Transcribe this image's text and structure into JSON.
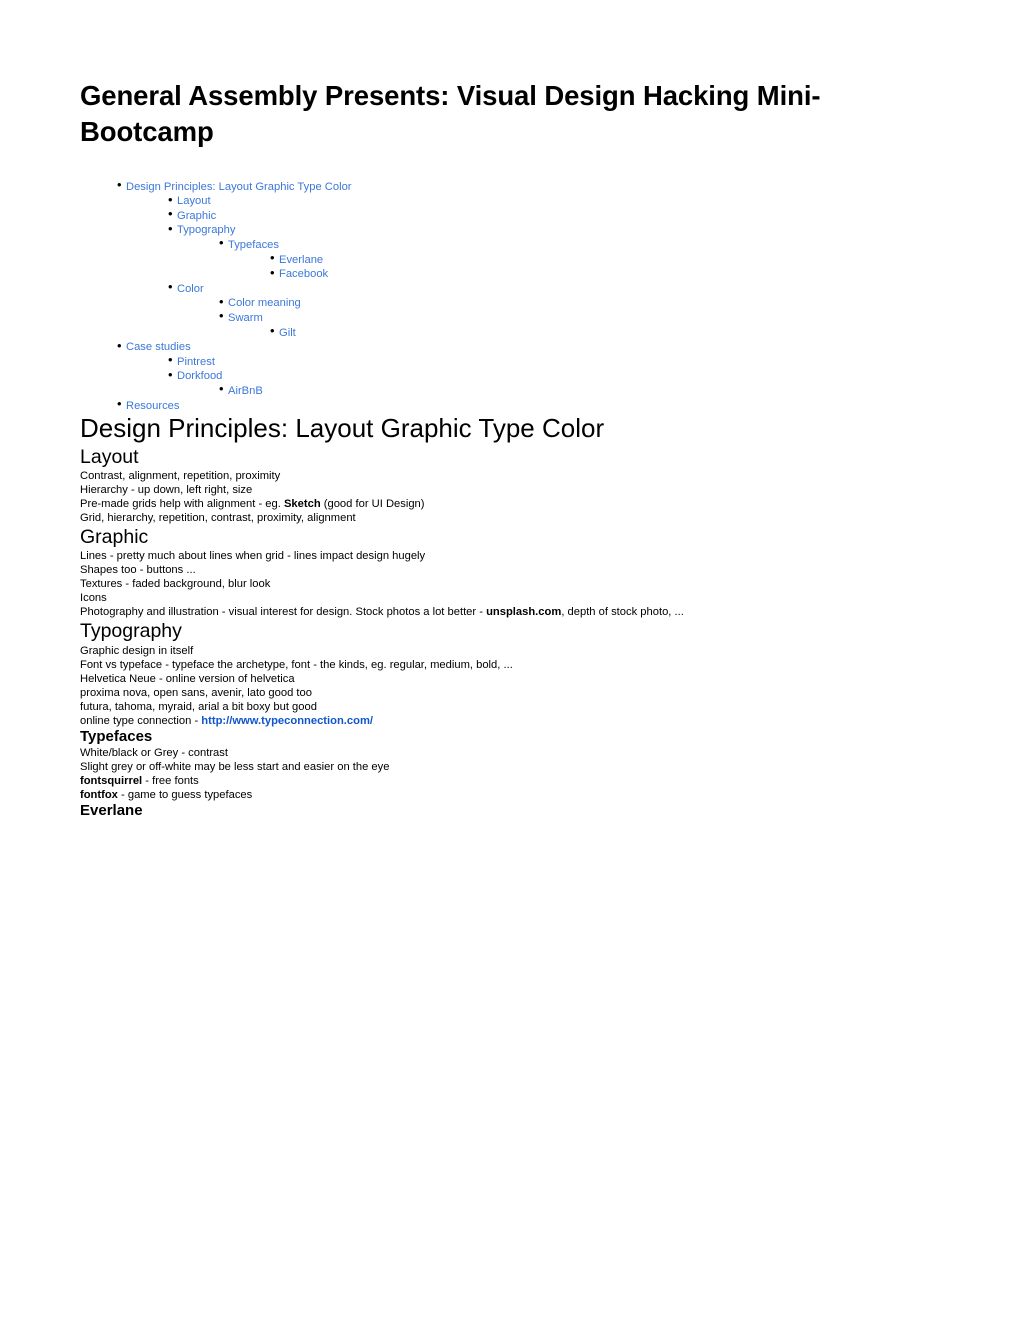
{
  "document": {
    "title": "General Assembly Presents: Visual Design Hacking Mini-Bootcamp",
    "link_color": "#3c78d8",
    "url_link_color": "#1155cc",
    "text_color": "#000000",
    "background": "#ffffff"
  },
  "toc": {
    "items": [
      {
        "level": 1,
        "label": "Design Principles: Layout Graphic Type Color"
      },
      {
        "level": 2,
        "label": "Layout"
      },
      {
        "level": 2,
        "label": "Graphic"
      },
      {
        "level": 2,
        "label": "Typography"
      },
      {
        "level": 3,
        "label": "Typefaces"
      },
      {
        "level": 4,
        "label": "Everlane"
      },
      {
        "level": 4,
        "label": "Facebook"
      },
      {
        "level": 2,
        "label": "Color"
      },
      {
        "level": 3,
        "label": "Color meaning"
      },
      {
        "level": 3,
        "label": "Swarm"
      },
      {
        "level": 4,
        "label": "Gilt"
      },
      {
        "level": 1,
        "label": "Case studies"
      },
      {
        "level": 2,
        "label": "Pintrest"
      },
      {
        "level": 2,
        "label": "Dorkfood"
      },
      {
        "level": 3,
        "label": "AirBnB"
      },
      {
        "level": 1,
        "label": "Resources"
      }
    ]
  },
  "sections": {
    "main_heading": "Design Principles: Layout Graphic Type Color",
    "layout": {
      "heading": "Layout",
      "paragraphs": [
        "Contrast, alignment, repetition, proximity",
        "Hierarchy - up down, left right, size",
        "Grid, hierarchy, repetition, contrast, proximity, alignment"
      ],
      "grids_line": {
        "prefix": "Pre-made grids help with alignment - eg. ",
        "bold": "Sketch",
        "suffix": " (good for UI Design)"
      }
    },
    "graphic": {
      "heading": "Graphic",
      "paragraphs": [
        "Lines - pretty much about lines when grid - lines impact design hugely",
        "Shapes too - buttons ...",
        "Textures - faded background, blur look",
        "Icons"
      ],
      "photography_line": {
        "prefix": "Photography and illustration - visual interest for design.  Stock photos a lot better - ",
        "bold": "unsplash.com",
        "suffix": ", depth of stock photo, ..."
      }
    },
    "typography": {
      "heading": "Typography",
      "paragraphs": [
        "Graphic design in itself",
        "Font vs typeface - typeface the archetype, font - the kinds, eg. regular, medium, bold, ...",
        "Helvetica Neue - online version of helvetica",
        "proxima nova, open sans, avenir, lato good too",
        "futura, tahoma, myraid, arial a bit boxy but good"
      ],
      "type_connection_line": {
        "prefix": "online type connection - ",
        "link": "http://www.typeconnection.com/"
      }
    },
    "typefaces": {
      "heading": "Typefaces",
      "paragraphs": [
        "White/black or Grey - contrast",
        "Slight grey or off-white may be less start and easier on the eye"
      ],
      "fontsquirrel_line": {
        "bold": "fontsquirrel",
        "suffix": " - free fonts"
      },
      "fontfox_line": {
        "bold": "fontfox",
        "suffix": " - game to guess typefaces"
      }
    },
    "everlane": {
      "heading": "Everlane"
    }
  }
}
